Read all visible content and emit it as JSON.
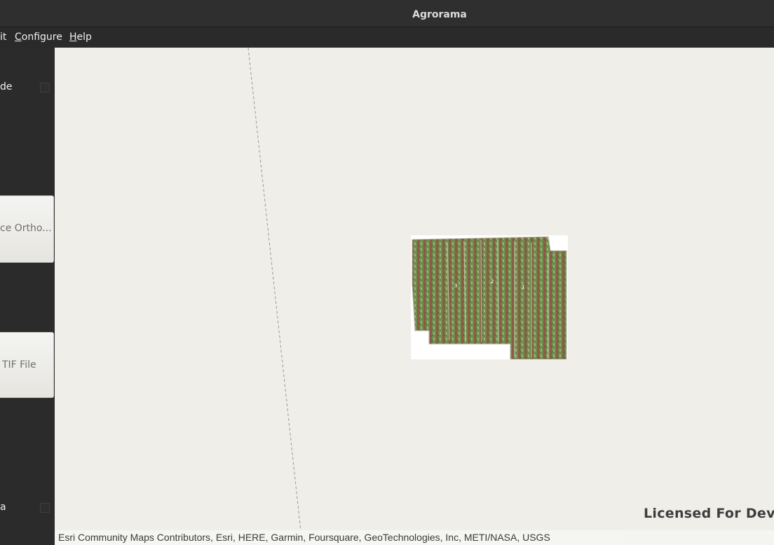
{
  "window": {
    "title": "Agrorama"
  },
  "menubar": {
    "items": [
      {
        "label": "it",
        "accel": ""
      },
      {
        "label": "onfigure",
        "accel": "C"
      },
      {
        "label": "elp",
        "accel": "H"
      }
    ]
  },
  "sidebar": {
    "mode_label": "de",
    "ortho_button_label": "ce Ortho...",
    "tif_button_label": "TIF File",
    "bottom_label": "a"
  },
  "map": {
    "watermark": "Licensed For Dev",
    "attribution": "Esri Community Maps Contributors, Esri, HERE, Garmin, Foursquare, GeoTechnologies, Inc, METI/NASA, USGS",
    "background_color": "#efeee9",
    "ortho_markers": [
      "3",
      "2",
      "1"
    ]
  },
  "colors": {
    "titlebar": "#2f2f2f",
    "sidebar": "#2b2b2b",
    "map": "#efeee9",
    "crop_green": "#6a8a4a",
    "crop_red": "#8a4a3a"
  }
}
